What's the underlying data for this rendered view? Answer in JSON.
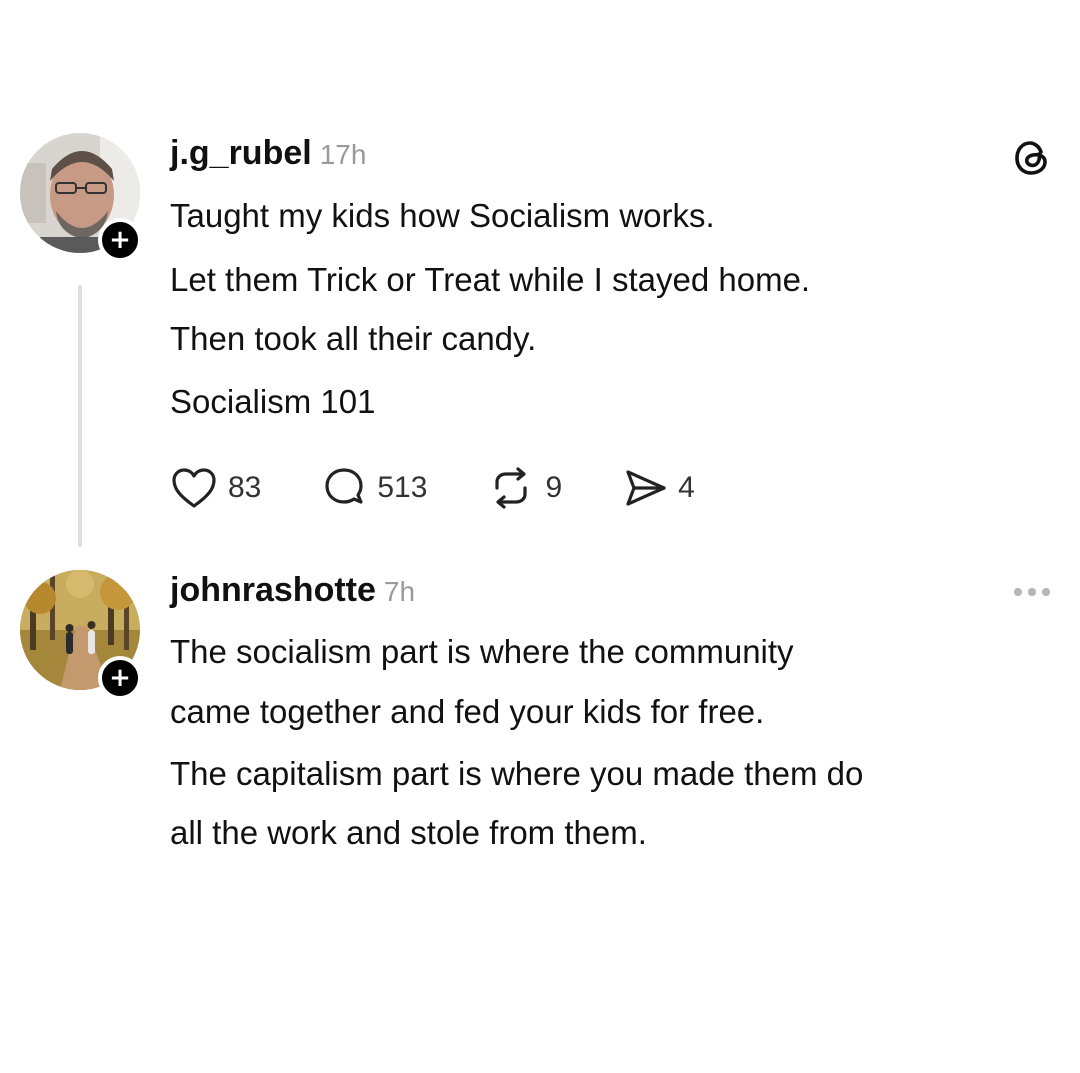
{
  "posts": [
    {
      "username": "j.g_rubel",
      "time": "17h",
      "lines": [
        "Taught my kids how Socialism works.",
        "Let them Trick or Treat while I stayed home.",
        "Then took all their candy.",
        "Socialism 101"
      ],
      "actions": {
        "likes": "83",
        "replies": "513",
        "reposts": "9",
        "shares": "4"
      },
      "follow_symbol": "+"
    },
    {
      "username": "johnrashotte",
      "time": "7h",
      "lines": [
        "The socialism part is where the community",
        "came together and fed your kids for free.",
        "The capitalism part is where you made them do",
        "all the work and stole from them."
      ],
      "follow_symbol": "+"
    }
  ],
  "icons": {
    "logo": "threads-logo-icon",
    "more": "more-options-icon",
    "like": "heart-icon",
    "reply": "comment-icon",
    "repost": "repost-icon",
    "share": "send-icon"
  }
}
